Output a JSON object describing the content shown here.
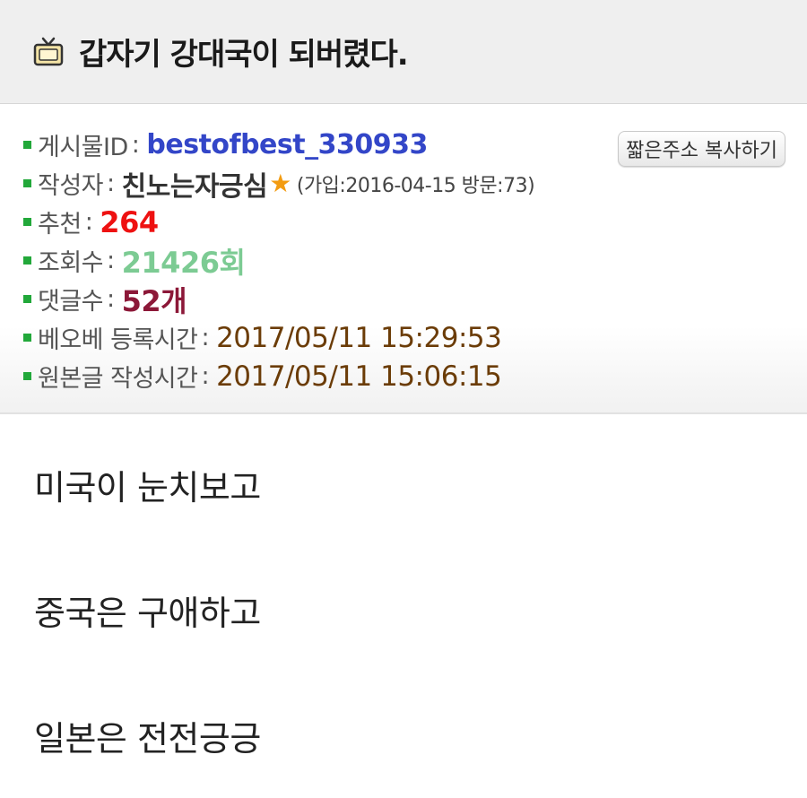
{
  "post": {
    "title": "갑자기 강대국이 되버렸다.",
    "icon": "tv-icon"
  },
  "meta": {
    "copy_button_label": "짧은주소 복사하기",
    "sep": ":",
    "rows": [
      {
        "label": "게시물ID",
        "value": "bestofbest_330933"
      },
      {
        "label": "작성자",
        "value": "친노는자긍심",
        "star": "★",
        "extra": "(가입:2016-04-15 방문:73)"
      },
      {
        "label": "추천",
        "value": "264"
      },
      {
        "label": "조회수",
        "value": "21426회"
      },
      {
        "label": "댓글수",
        "value": "52개"
      },
      {
        "label": "베오베 등록시간",
        "value": "2017/05/11 15:29:53"
      },
      {
        "label": "원본글 작성시간",
        "value": "2017/05/11 15:06:15"
      }
    ]
  },
  "content": {
    "lines": [
      "미국이 눈치보고",
      "중국은 구애하고",
      "일본은 전전긍긍"
    ]
  },
  "colors": {
    "bullet": "#22a83a",
    "post_id": "#3346c8",
    "recommend": "#ee1111",
    "views": "#7ccb93",
    "comments": "#8c1838",
    "time": "#6b3c07",
    "star": "#f39c12"
  }
}
